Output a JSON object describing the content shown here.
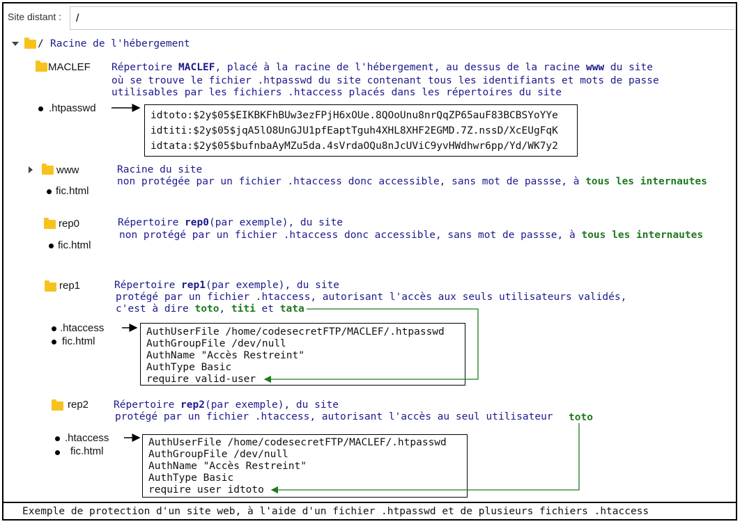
{
  "address_bar": {
    "label": "Site distant :",
    "value": "/"
  },
  "tree": {
    "root": {
      "slash": "/",
      "label": "Racine de l'hébergement"
    },
    "maclef": {
      "folder": "MACLEF",
      "desc1_a": "Répertoire",
      "desc1_b": "MACLEF",
      "desc1_c": ", placé à la racine de l'hébergement",
      "desc1_d": ", au dessus de la racine",
      "desc1_e": "www",
      "desc1_f": "du site",
      "desc2": "où se trouve le fichier .htpasswd du site contenant tous les identifiants et mots de passe",
      "desc3": "utilisables par les fichiers .htaccess placés dans les répertoires du site",
      "file": ".htpasswd",
      "htpasswd_lines": [
        "idtoto:$2y$05$EIKBKFhBUw3ezFPjH6xOUe.8QOoUnu8nrQqZP65auF83BCBSYoYYe",
        "idtiti:$2y$05$jqA5lO8UnGJU1pfEaptTguh4XHL8XHF2EGMD.7Z.nssD/XcEUgFqK",
        "idtata:$2y$05$bufnbaAyMZu5da.4sVrdaOQu8nJcUViC9yvHWdhwr6pp/Yd/WK7y2"
      ]
    },
    "www": {
      "folder": "www",
      "desc1": "Racine du site",
      "desc2": "non protégée par un fichier .htaccess donc accessible, sans mot de passse, à",
      "desc2_green": "tous les internautes",
      "file": "fic.html"
    },
    "rep0": {
      "folder": "rep0",
      "desc1_a": "Répertoire",
      "desc1_b": "rep0",
      "desc1_c": "(par exemple)",
      "desc1_d": ", du site",
      "desc2": "non protégé par un fichier .htaccess donc accessible, sans mot de passse, à",
      "desc2_green": "tous les internautes",
      "file": "fic.html"
    },
    "rep1": {
      "folder": "rep1",
      "desc1_a": "Répertoire",
      "desc1_b": "rep1",
      "desc1_c": "(par exemple)",
      "desc1_d": ", du site",
      "desc2": "protégé par un fichier .htaccess, autorisant l'accès aux seuls utilisateurs validés,",
      "desc3_a": "c'est à dire",
      "desc3_b": "toto",
      "desc3_c": ",",
      "desc3_d": "titi",
      "desc3_e": "et",
      "desc3_f": "tata",
      "file1": ".htaccess",
      "file2": "fic.html",
      "htaccess_lines": [
        "AuthUserFile /home/codesecretFTP/MACLEF/.htpasswd",
        "AuthGroupFile /dev/null",
        "AuthName \"Accès Restreint\"",
        "AuthType Basic",
        "require valid-user"
      ]
    },
    "rep2": {
      "folder": "rep2",
      "desc1_a": "Répertoire",
      "desc1_b": "rep2",
      "desc1_c": "(par exemple)",
      "desc1_d": ", du site",
      "desc2": "protégé par un fichier .htaccess, autorisant l'accès au seul utilisateur",
      "desc2_green": "toto",
      "file1": ".htaccess",
      "file2": "fic.html",
      "htaccess_lines": [
        "AuthUserFile /home/codesecretFTP/MACLEF/.htpasswd",
        "AuthGroupFile /dev/null",
        "AuthName \"Accès Restreint\"",
        "AuthType Basic",
        "require user idtoto"
      ]
    }
  },
  "caption": "Exemple de protection d'un site web, à l'aide d'un fichier .htpasswd et de plusieurs fichiers .htaccess",
  "colors": {
    "folder": "#f7c21c",
    "desc_text": "#1a1a8c",
    "highlight": "#1f7a1f",
    "arrow_green": "#1f7a1f"
  }
}
